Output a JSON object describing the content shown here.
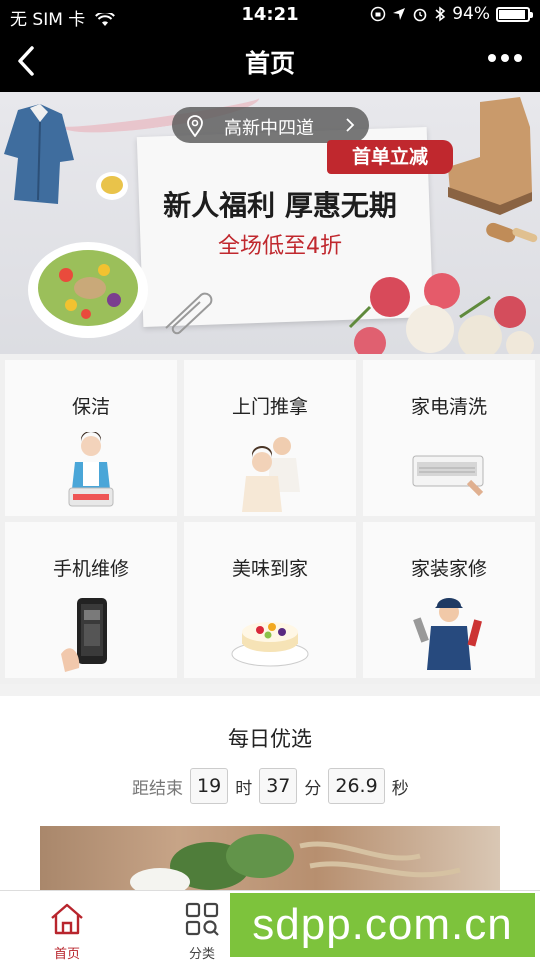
{
  "status_bar": {
    "carrier": "无 SIM 卡",
    "time": "14:21",
    "battery": "94%",
    "battery_level": 0.94
  },
  "nav": {
    "title": "首页"
  },
  "banner": {
    "location": "高新中四道",
    "tag": "首单立减",
    "headline": "新人福利  厚惠无期",
    "subline": "全场低至4折"
  },
  "services": [
    {
      "label": "保洁",
      "icon": "cleaner-photo"
    },
    {
      "label": "上门推拿",
      "icon": "massage-photo"
    },
    {
      "label": "家电清洗",
      "icon": "air-conditioner-photo"
    },
    {
      "label": "手机维修",
      "icon": "phone-repair-photo"
    },
    {
      "label": "美味到家",
      "icon": "fruit-cake-photo"
    },
    {
      "label": "家装家修",
      "icon": "handyman-photo"
    }
  ],
  "daily": {
    "heading": "每日优选",
    "countdown_prefix": "距结束",
    "hours": "19",
    "hours_unit": "时",
    "minutes": "37",
    "minutes_unit": "分",
    "seconds": "26.9",
    "seconds_unit": "秒"
  },
  "tabs": [
    {
      "label": "首页",
      "icon": "home-icon",
      "active": true
    },
    {
      "label": "分类",
      "icon": "category-icon",
      "active": false
    }
  ],
  "watermark": "sdpp.com.cn",
  "colors": {
    "accent": "#b8252d",
    "bar": "#000000",
    "watermark": "#7dc33c"
  }
}
